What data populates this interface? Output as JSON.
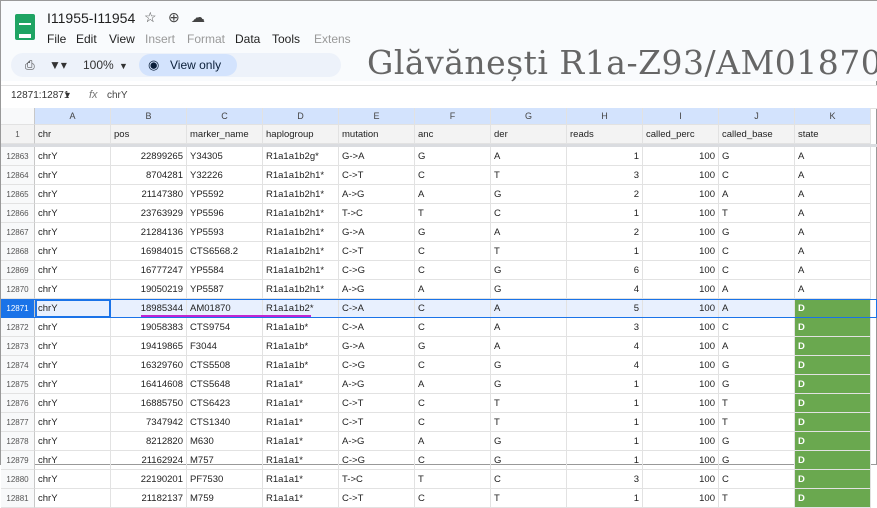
{
  "header": {
    "title": "I11955-I11954",
    "overlay_title": "Glăvănești R1a-Z93/AM01870",
    "menu": [
      "File",
      "Edit",
      "View",
      "Insert",
      "Format",
      "Data",
      "Tools",
      "Extens"
    ],
    "zoom": "100%",
    "view_only": "View only"
  },
  "formula_bar": {
    "name_box": "12871:12871",
    "fx": "fx",
    "value": "chrY"
  },
  "columns": [
    "A",
    "B",
    "C",
    "D",
    "E",
    "F",
    "G",
    "H",
    "I",
    "J",
    "K"
  ],
  "header_row": {
    "num": "1",
    "cells": [
      "chr",
      "pos",
      "marker_name",
      "haplogroup",
      "mutation",
      "anc",
      "der",
      "reads",
      "called_perc",
      "called_base",
      "state"
    ]
  },
  "rows": [
    {
      "num": "12863",
      "cells": [
        "chrY",
        "22899265",
        "Y34305",
        "R1a1a1b2g*",
        "G->A",
        "G",
        "A",
        "1",
        "100",
        "G",
        "A"
      ]
    },
    {
      "num": "12864",
      "cells": [
        "chrY",
        "8704281",
        "Y32226",
        "R1a1a1b2h1*",
        "C->T",
        "C",
        "T",
        "3",
        "100",
        "C",
        "A"
      ]
    },
    {
      "num": "12865",
      "cells": [
        "chrY",
        "21147380",
        "YP5592",
        "R1a1a1b2h1*",
        "A->G",
        "A",
        "G",
        "2",
        "100",
        "A",
        "A"
      ]
    },
    {
      "num": "12866",
      "cells": [
        "chrY",
        "23763929",
        "YP5596",
        "R1a1a1b2h1*",
        "T->C",
        "T",
        "C",
        "1",
        "100",
        "T",
        "A"
      ]
    },
    {
      "num": "12867",
      "cells": [
        "chrY",
        "21284136",
        "YP5593",
        "R1a1a1b2h1*",
        "G->A",
        "G",
        "A",
        "2",
        "100",
        "G",
        "A"
      ]
    },
    {
      "num": "12868",
      "cells": [
        "chrY",
        "16984015",
        "CTS6568.2",
        "R1a1a1b2h1*",
        "C->T",
        "C",
        "T",
        "1",
        "100",
        "C",
        "A"
      ]
    },
    {
      "num": "12869",
      "cells": [
        "chrY",
        "16777247",
        "YP5584",
        "R1a1a1b2h1*",
        "C->G",
        "C",
        "G",
        "6",
        "100",
        "C",
        "A"
      ]
    },
    {
      "num": "12870",
      "cells": [
        "chrY",
        "19050219",
        "YP5587",
        "R1a1a1b2h1*",
        "A->G",
        "A",
        "G",
        "4",
        "100",
        "A",
        "A"
      ]
    },
    {
      "num": "12871",
      "cells": [
        "chrY",
        "18985344",
        "AM01870",
        "R1a1a1b2*",
        "C->A",
        "C",
        "A",
        "5",
        "100",
        "A",
        "D"
      ]
    },
    {
      "num": "12872",
      "cells": [
        "chrY",
        "19058383",
        "CTS9754",
        "R1a1a1b*",
        "C->A",
        "C",
        "A",
        "3",
        "100",
        "C",
        "D"
      ]
    },
    {
      "num": "12873",
      "cells": [
        "chrY",
        "19419865",
        "F3044",
        "R1a1a1b*",
        "G->A",
        "G",
        "A",
        "4",
        "100",
        "A",
        "D"
      ]
    },
    {
      "num": "12874",
      "cells": [
        "chrY",
        "16329760",
        "CTS5508",
        "R1a1a1b*",
        "C->G",
        "C",
        "G",
        "4",
        "100",
        "G",
        "D"
      ]
    },
    {
      "num": "12875",
      "cells": [
        "chrY",
        "16414608",
        "CTS5648",
        "R1a1a1*",
        "A->G",
        "A",
        "G",
        "1",
        "100",
        "G",
        "D"
      ]
    },
    {
      "num": "12876",
      "cells": [
        "chrY",
        "16885750",
        "CTS6423",
        "R1a1a1*",
        "C->T",
        "C",
        "T",
        "1",
        "100",
        "T",
        "D"
      ]
    },
    {
      "num": "12877",
      "cells": [
        "chrY",
        "7347942",
        "CTS1340",
        "R1a1a1*",
        "C->T",
        "C",
        "T",
        "1",
        "100",
        "T",
        "D"
      ]
    },
    {
      "num": "12878",
      "cells": [
        "chrY",
        "8212820",
        "M630",
        "R1a1a1*",
        "A->G",
        "A",
        "G",
        "1",
        "100",
        "G",
        "D"
      ]
    },
    {
      "num": "12879",
      "cells": [
        "chrY",
        "21162924",
        "M757",
        "R1a1a1*",
        "C->G",
        "C",
        "G",
        "1",
        "100",
        "G",
        "D"
      ]
    },
    {
      "num": "12880",
      "cells": [
        "chrY",
        "22190201",
        "PF7530",
        "R1a1a1*",
        "T->C",
        "T",
        "C",
        "3",
        "100",
        "C",
        "D"
      ]
    },
    {
      "num": "12881",
      "cells": [
        "chrY",
        "21182137",
        "M759",
        "R1a1a1*",
        "C->T",
        "C",
        "T",
        "1",
        "100",
        "T",
        "D"
      ]
    }
  ],
  "colors": {
    "state_d": "#6aa84f",
    "selection": "#1a73e8",
    "underline": "#c026d3",
    "sheets_green": "#1fa463"
  }
}
